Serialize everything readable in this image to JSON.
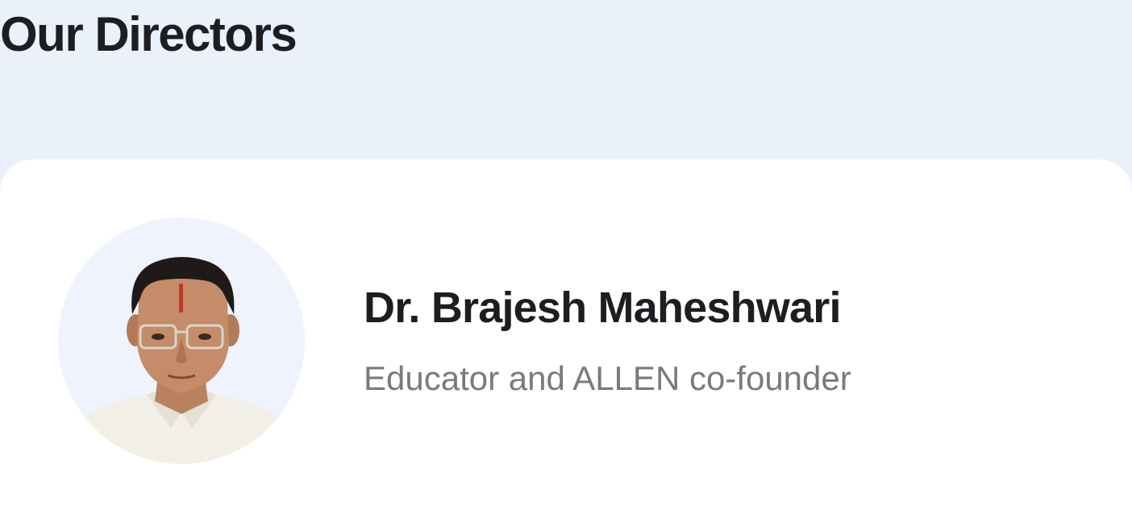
{
  "section": {
    "title": "Our Directors"
  },
  "directors": [
    {
      "name": "Dr. Brajesh Maheshwari",
      "role": "Educator and ALLEN co-founder",
      "photo": "portrait-photo"
    }
  ],
  "colors": {
    "page_background": "#ebf1fa",
    "card_background": "#ffffff",
    "avatar_background": "#eff3fd",
    "title_text": "#1d1d22",
    "subtitle_text": "#7a7a7a"
  }
}
